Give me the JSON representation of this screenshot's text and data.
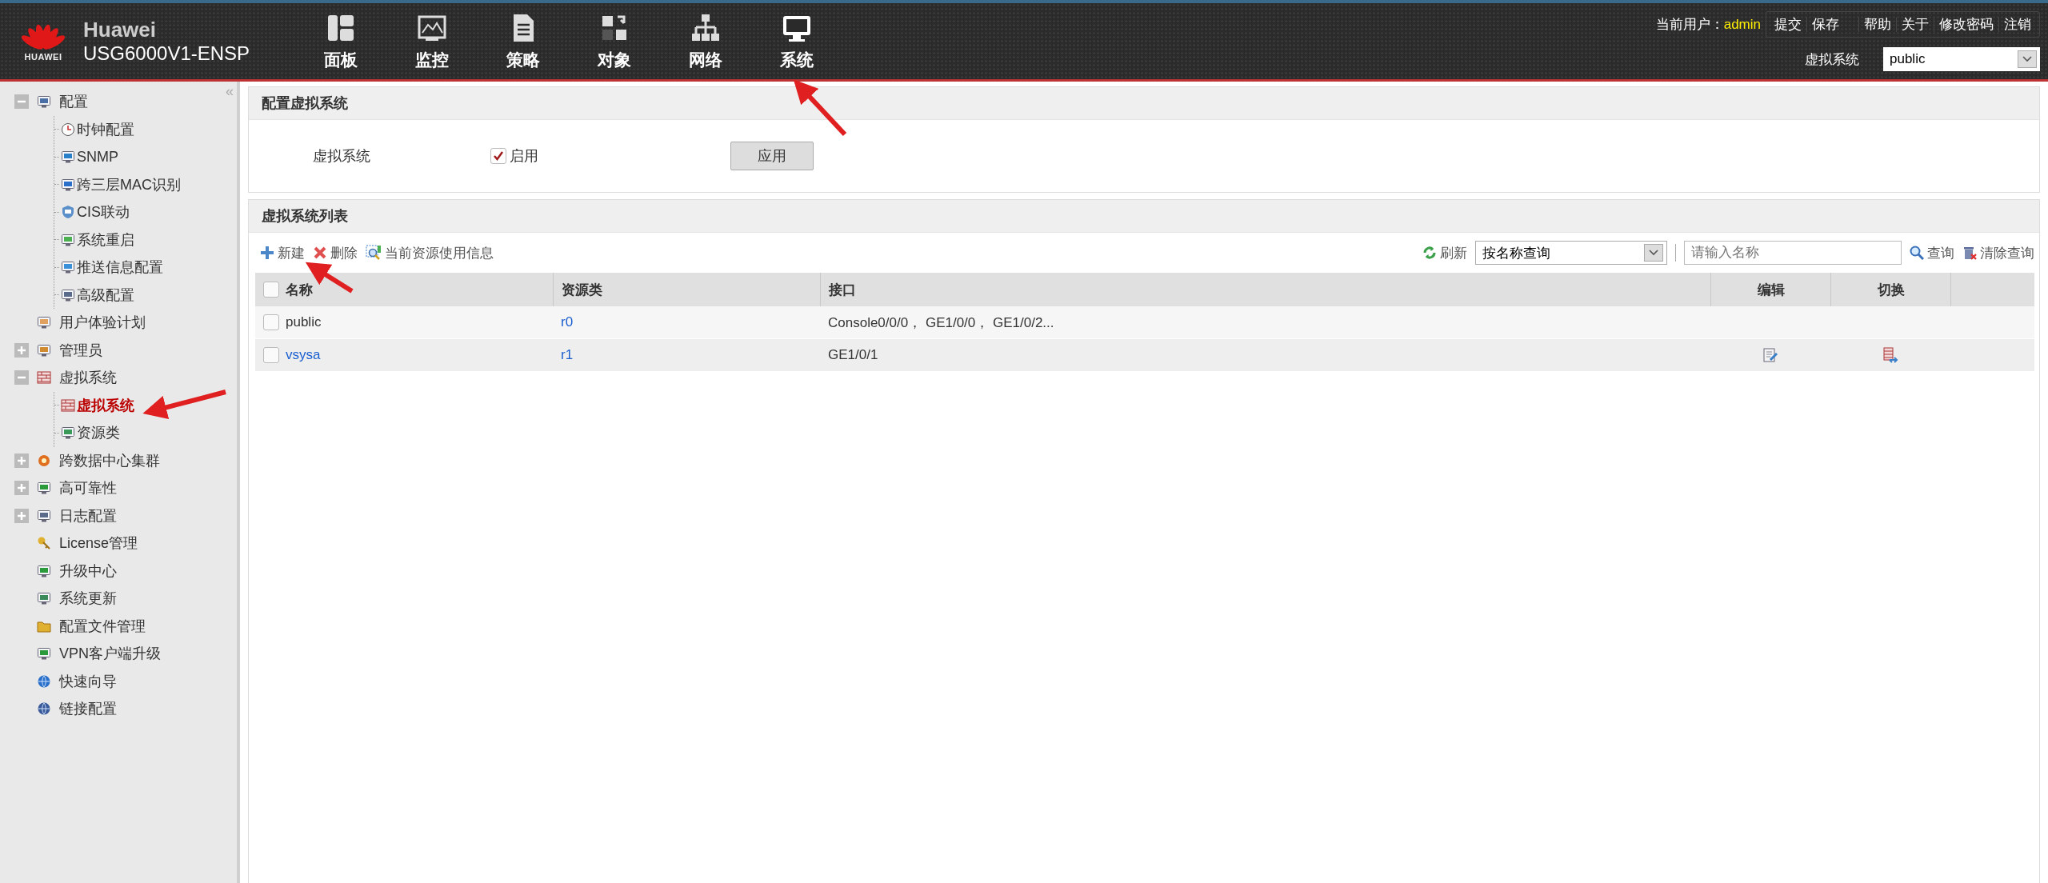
{
  "header": {
    "logo_text": "HUAWEI",
    "title": "Huawei",
    "model": "USG6000V1-ENSP",
    "nav": [
      "面板",
      "监控",
      "策略",
      "对象",
      "网络",
      "系统"
    ],
    "user_label": "当前用户：",
    "user_name": "admin",
    "action_groups": [
      [
        "提交",
        "保存"
      ],
      [
        "帮助",
        "关于",
        "修改密码",
        "注销"
      ]
    ],
    "vsys_label": "虚拟系统",
    "vsys_value": "public"
  },
  "sidebar": {
    "collapse": "«",
    "items": [
      {
        "label": "配置",
        "kind": "group",
        "expanded": true,
        "selected": false,
        "children": [
          {
            "label": "时钟配置",
            "selected": false
          },
          {
            "label": "SNMP",
            "selected": false
          },
          {
            "label": "跨三层MAC识别",
            "selected": false
          },
          {
            "label": "CIS联动",
            "selected": false
          },
          {
            "label": "系统重启",
            "selected": false
          },
          {
            "label": "推送信息配置",
            "selected": false
          },
          {
            "label": "高级配置",
            "selected": false
          }
        ]
      },
      {
        "label": "用户体验计划",
        "kind": "item",
        "selected": false
      },
      {
        "label": "管理员",
        "kind": "group",
        "expanded": false,
        "selected": false
      },
      {
        "label": "虚拟系统",
        "kind": "group",
        "expanded": true,
        "selected": false,
        "children": [
          {
            "label": "虚拟系统",
            "selected": true
          },
          {
            "label": "资源类",
            "selected": false
          }
        ]
      },
      {
        "label": "跨数据中心集群",
        "kind": "group",
        "expanded": false,
        "selected": false
      },
      {
        "label": "高可靠性",
        "kind": "group",
        "expanded": false,
        "selected": false
      },
      {
        "label": "日志配置",
        "kind": "group",
        "expanded": false,
        "selected": false
      },
      {
        "label": "License管理",
        "kind": "item",
        "selected": false
      },
      {
        "label": "升级中心",
        "kind": "item",
        "selected": false
      },
      {
        "label": "系统更新",
        "kind": "item",
        "selected": false
      },
      {
        "label": "配置文件管理",
        "kind": "item",
        "selected": false
      },
      {
        "label": "VPN客户端升级",
        "kind": "item",
        "selected": false
      },
      {
        "label": "快速向导",
        "kind": "item",
        "selected": false
      },
      {
        "label": "链接配置",
        "kind": "item",
        "selected": false
      }
    ]
  },
  "config_panel": {
    "title": "配置虚拟系统",
    "field_label": "虚拟系统",
    "enable_label": "启用",
    "enabled": true,
    "apply_button": "应用"
  },
  "list_panel": {
    "title": "虚拟系统列表",
    "actions": [
      "新建",
      "删除",
      "当前资源使用信息"
    ],
    "refresh": "刷新",
    "query_select": "按名称查询",
    "search": {
      "placeholder": "请输入名称"
    },
    "query": "查询",
    "clear_query": "清除查询",
    "table": {
      "columns": [
        "名称",
        "资源类",
        "接口",
        "编辑",
        "切换"
      ],
      "all_checked": false,
      "rows": [
        {
          "checked": false,
          "name": "public",
          "name_is_link": false,
          "resource": "r0",
          "interfaces": "Console0/0/0， GE1/0/0， GE1/0/2...",
          "editable": false
        },
        {
          "checked": false,
          "name": "vsysa",
          "name_is_link": true,
          "resource": "r1",
          "interfaces": "GE1/0/1",
          "editable": true
        }
      ]
    }
  }
}
